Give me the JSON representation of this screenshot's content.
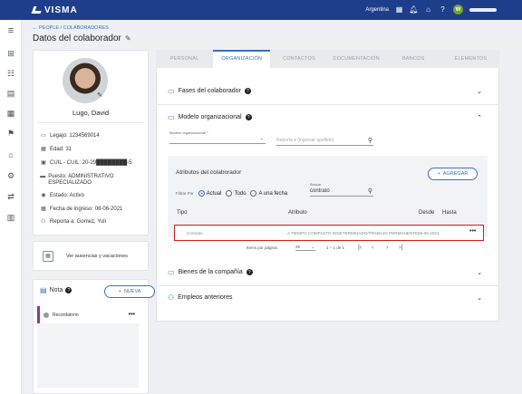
{
  "topbar": {
    "brand": "VISMA",
    "country": "Argentina",
    "user_initial": "W"
  },
  "breadcrumb": "PEOPLE / COLABORADORES",
  "page_title": "Datos del colaborador",
  "profile": {
    "name": "Lugo, David",
    "fields": [
      {
        "icon": "folder-icon",
        "text": "Legajo: 1234569014"
      },
      {
        "icon": "calendar-icon",
        "text": "Edad: 31"
      },
      {
        "icon": "id-card-icon",
        "text": "CUIL - CUIL: 20-29████████-5"
      },
      {
        "icon": "briefcase-icon",
        "text": "Puesto: ADMINISTRATIVO ESPECIALIZADO"
      },
      {
        "icon": "status-icon",
        "text": "Estado: Activo"
      },
      {
        "icon": "calendar-icon",
        "text": "Fecha de ingreso: 08-06-2021"
      },
      {
        "icon": "people-icon",
        "text": "Reporta a: Gomez, Yuli"
      }
    ]
  },
  "ausencias_label": "Ver ausencias y vacaciones",
  "nota": {
    "title": "Nota",
    "new_label": "NUEVA",
    "item": "Recordatorio"
  },
  "tabs": [
    "PERSONAL",
    "ORGANIZACIÓN",
    "CONTACTOS",
    "DOCUMENTACIÓN",
    "BANCOS",
    "ELEMENTOS"
  ],
  "active_tab": 1,
  "sections": {
    "fases": "Fases del colaborador",
    "modelo": "Modelo organizacional",
    "bienes": "Bienes de la compañía",
    "empleos": "Empleos anteriores"
  },
  "modelo_field": {
    "label": "Modelo organizacional *"
  },
  "reporta_placeholder": "Reporta a (ingresar apellido)",
  "atributos": {
    "title": "Atributos del colaborador",
    "add_label": "AGREGAR",
    "filter_label": "Filtrar Por",
    "options": [
      "Actual",
      "Todo",
      "A una fecha"
    ],
    "selected": "Actual",
    "search_label": "Buscar",
    "search_value": "contrato"
  },
  "table": {
    "headers": [
      "Tipo",
      "Atributo",
      "Desde",
      "Hasta"
    ],
    "rows": [
      {
        "tipo": "Contrato",
        "atributo": "A TIEMPO COMPLETO INDETERMINADO/TRABAJO PERMANENTE",
        "desde": "08-06-2021",
        "hasta": ""
      }
    ]
  },
  "pagination": {
    "label": "Items por página:",
    "size": "25",
    "range": "1 – 1 de 1"
  }
}
